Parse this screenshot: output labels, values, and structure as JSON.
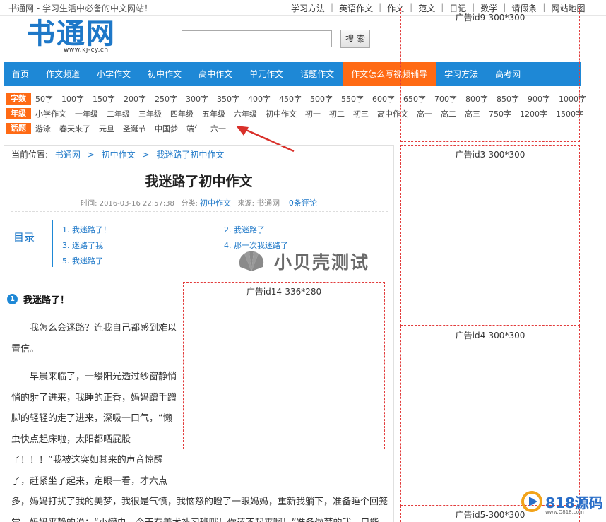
{
  "topbar": {
    "slogan": "书通网 - 学习生活中必备的中文网站！",
    "links": [
      "学习方法",
      "英语作文",
      "作文",
      "范文",
      "日记",
      "数学",
      "请假条",
      "网站地图"
    ]
  },
  "header": {
    "logo_text": "书通网",
    "logo_url": "www.kj-cy.cn",
    "search_placeholder": "",
    "search_button": "搜 索"
  },
  "nav": {
    "items": [
      "首页",
      "作文频道",
      "小学作文",
      "初中作文",
      "高中作文",
      "单元作文",
      "话题作文",
      "作文怎么写视频辅导",
      "学习方法",
      "高考网"
    ],
    "active_index": 7
  },
  "tags": {
    "rows": [
      {
        "label": "字数",
        "items": [
          "50字",
          "100字",
          "150字",
          "200字",
          "250字",
          "300字",
          "350字",
          "400字",
          "450字",
          "500字",
          "550字",
          "600字",
          "650字",
          "700字",
          "800字",
          "850字",
          "900字",
          "1000字"
        ]
      },
      {
        "label": "年级",
        "items": [
          "小学作文",
          "一年级",
          "二年级",
          "三年级",
          "四年级",
          "五年级",
          "六年级",
          "初中作文",
          "初一",
          "初二",
          "初三",
          "高中作文",
          "高一",
          "高二",
          "高三",
          "750字",
          "1200字",
          "1500字"
        ]
      },
      {
        "label": "话题",
        "items": [
          "游泳",
          "春天来了",
          "元旦",
          "圣诞节",
          "中国梦",
          "端午",
          "六一"
        ]
      }
    ]
  },
  "breadcrumb": {
    "prefix": "当前位置:",
    "items": [
      "书通网",
      "初中作文",
      "我迷路了初中作文"
    ]
  },
  "article": {
    "title": "我迷路了初中作文",
    "meta": {
      "time_label": "时间:",
      "time": "2016-03-16 22:57:38",
      "category_label": "分类:",
      "category": "初中作文",
      "source_label": "来源:",
      "source": "书通网",
      "comments": "0条评论"
    },
    "toc_title": "目录",
    "toc": [
      "1. 我迷路了！",
      "2. 我迷路了",
      "3. 迷路了我",
      "4. 那一次我迷路了",
      "5. 我迷路了"
    ],
    "section": {
      "number": "1",
      "title": "我迷路了！"
    },
    "paragraphs_narrow": [
      [
        "我怎么会迷路？连我自己都感到难以",
        "置信。"
      ],
      [
        "早晨来临了，一缕阳光透过纱窗静悄",
        "悄的射了进来，我睡的正香，妈妈蹭手蹭",
        "脚的轻轻的走了进来，深吸一口气，“懒",
        "虫快点起床啦，太阳都晒屁股",
        "了！！！”我被这突如其来的声音惊醒",
        "了，赶紧坐了起来，定眼一看，才六点"
      ]
    ],
    "paragraphs_wide": [
      "多，妈妈打扰了我的美梦，我很是气愤，我恼怒的瞪了一眼妈妈，重新我躺下，准备睡个回笼",
      "觉，妈妈平静的说：“小懒虫，今天有美术补习班哦！你还不起来啊！”准备做梦的我，只能"
    ]
  },
  "watermark": "小贝壳测试",
  "ads": {
    "a9": "广告id9-300*300",
    "a3": "广告id3-300*300",
    "a4": "广告id4-300*300",
    "a5": "广告id5-300*300",
    "a14": "广告id14-336*280"
  },
  "corner_logo": {
    "text": "818源码",
    "sub": "www.Q818.com"
  },
  "colors": {
    "brand_blue": "#1e88d6",
    "accent_orange": "#ff6a14",
    "ad_border": "#e23c3c"
  }
}
